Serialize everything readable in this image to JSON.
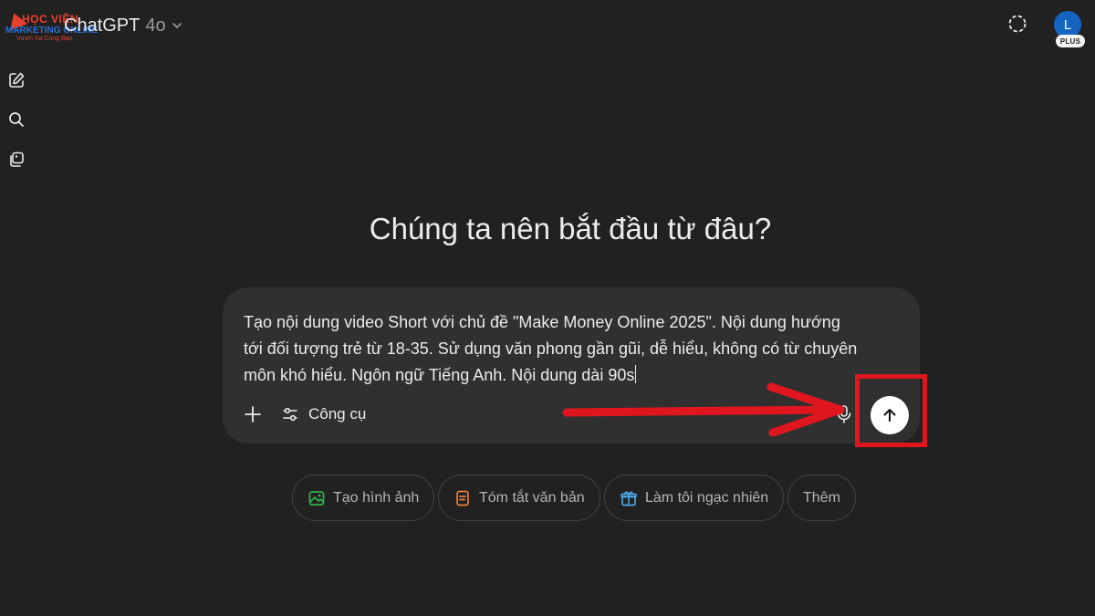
{
  "watermark": {
    "line1": "HỌC VIỆN",
    "line2": "MARKETING ONLINE",
    "line3": "Vươn Xa Cùng Bạn"
  },
  "header": {
    "model_name": "ChatGPT",
    "model_version": "4o",
    "avatar_initial": "L",
    "plan_badge": "PLUS"
  },
  "sidebar": {
    "icons": [
      "new-chat-icon",
      "search-icon",
      "library-icon"
    ]
  },
  "main": {
    "headline": "Chúng ta nên bắt đầu từ đâu?"
  },
  "composer": {
    "prompt_lines": [
      "Tạo nội dung video Short với chủ đề \"Make Money Online 2025\". Nội dung hướng",
      "tới đối tượng trẻ từ 18-35. Sử dụng văn phong gần gũi, dễ hiểu, không có từ chuyên",
      "môn khó hiểu. Ngôn ngữ Tiếng Anh. Nội dung dài 90s"
    ],
    "tools_label": "Công cụ"
  },
  "chips": [
    {
      "label": "Tạo hình ảnh",
      "icon": "image-icon",
      "color": "#2fb34a"
    },
    {
      "label": "Tóm tắt văn bản",
      "icon": "document-icon",
      "color": "#e8803a"
    },
    {
      "label": "Làm tôi ngạc nhiên",
      "icon": "gift-icon",
      "color": "#4aa8e8"
    },
    {
      "label": "Thêm",
      "icon": "",
      "color": ""
    }
  ],
  "colors": {
    "background": "#212121",
    "composer": "#303030",
    "annotation": "#e0161e",
    "avatar": "#1565c0"
  }
}
